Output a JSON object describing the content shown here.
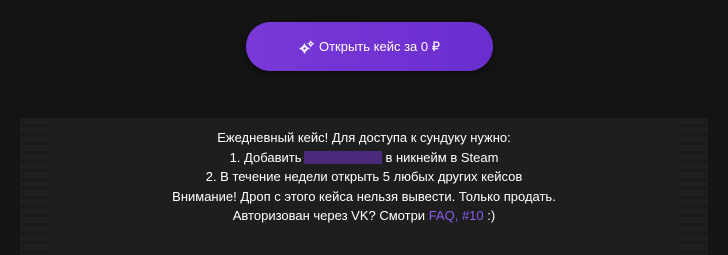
{
  "open_case": {
    "label": "Открыть кейс за 0 ₽",
    "icon": "gears-icon",
    "accent_color": "#7a38d8"
  },
  "info": {
    "line1": "Ежедневный кейс! Для доступа к сундуку нужно:",
    "line2_prefix": "1. Добавить",
    "line2_suffix": "в никнейм в Steam",
    "line3": "2. В течение недели открыть 5 любых других кейсов",
    "line4": "Внимание! Дроп с этого кейса нельзя вывести. Только продать.",
    "line5_prefix": "Авторизован через VK? Смотри",
    "faq_link": "FAQ,",
    "faq_item_link": "#10",
    "line5_suffix": ":)",
    "link_color": "#8a5cf0"
  }
}
